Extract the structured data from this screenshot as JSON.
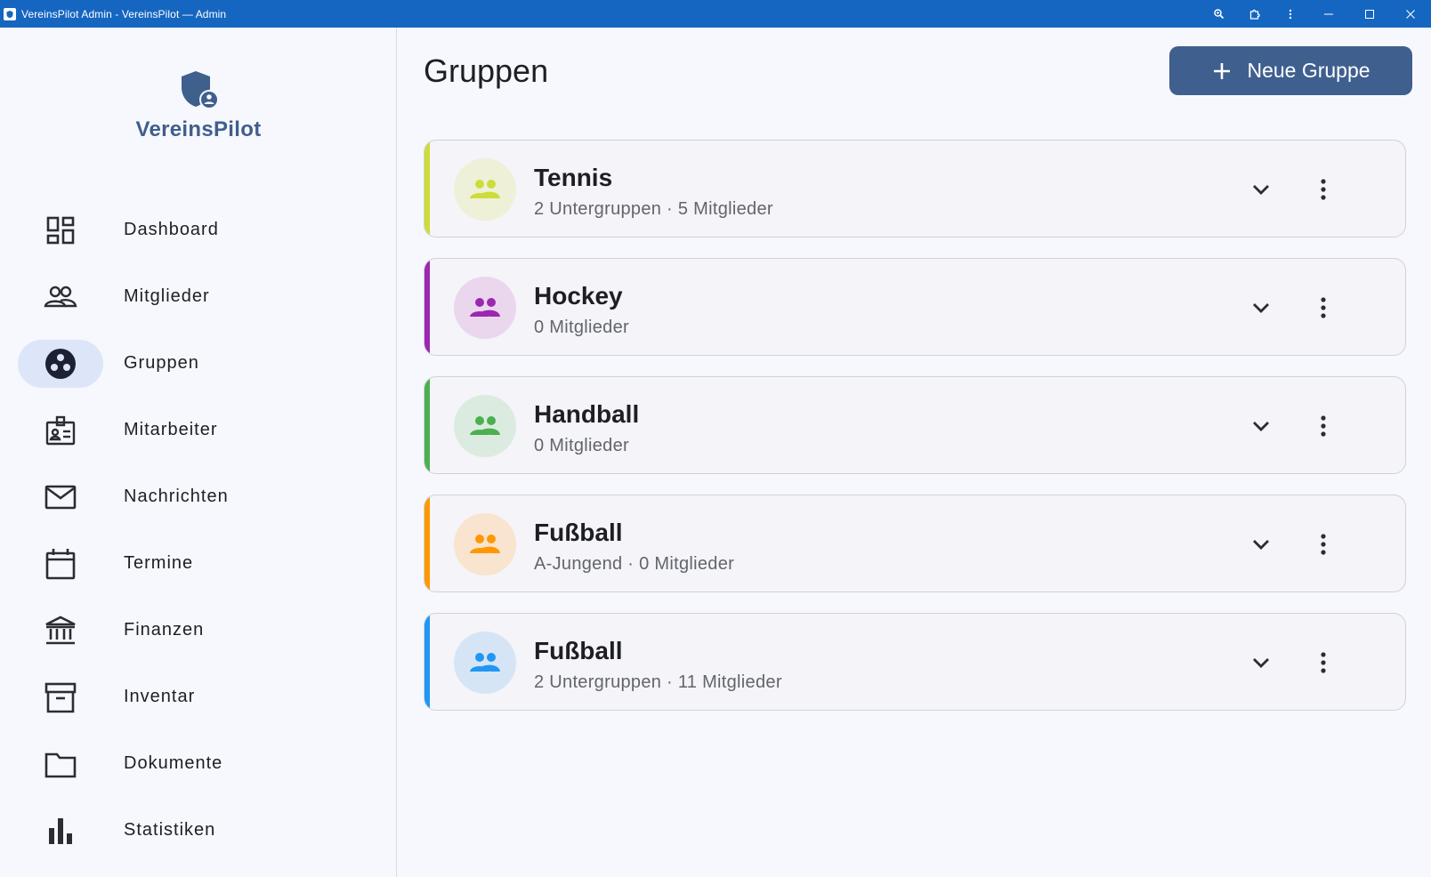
{
  "window": {
    "title": "VereinsPilot Admin - VereinsPilot — Admin",
    "controls": [
      "zoom-icon",
      "extensions-icon",
      "more-vert-icon",
      "minimize-icon",
      "maximize-icon",
      "close-icon"
    ]
  },
  "brand": {
    "name": "VereinsPilot",
    "logo_icon": "shield-user-icon",
    "color": "#3f5f8c"
  },
  "sidebar": {
    "items": [
      {
        "label": "Dashboard",
        "icon": "dashboard-icon",
        "active": false
      },
      {
        "label": "Mitglieder",
        "icon": "people-icon",
        "active": false
      },
      {
        "label": "Gruppen",
        "icon": "workspaces-icon",
        "active": true
      },
      {
        "label": "Mitarbeiter",
        "icon": "badge-icon",
        "active": false
      },
      {
        "label": "Nachrichten",
        "icon": "mail-icon",
        "active": false
      },
      {
        "label": "Termine",
        "icon": "calendar-icon",
        "active": false
      },
      {
        "label": "Finanzen",
        "icon": "bank-icon",
        "active": false
      },
      {
        "label": "Inventar",
        "icon": "archive-icon",
        "active": false
      },
      {
        "label": "Dokumente",
        "icon": "folder-icon",
        "active": false
      },
      {
        "label": "Statistiken",
        "icon": "bar-chart-icon",
        "active": false
      }
    ]
  },
  "main": {
    "title": "Gruppen",
    "new_button_label": "Neue Gruppe",
    "accent_color": "#3f5f8f",
    "groups": [
      {
        "name": "Tennis",
        "meta": "2 Untergruppen · 5 Mitglieder",
        "color": "#cddc39",
        "avatar_bg": "#eef1d8"
      },
      {
        "name": "Hockey",
        "meta": "0 Mitglieder",
        "color": "#9c27b0",
        "avatar_bg": "#ead7ee"
      },
      {
        "name": "Handball",
        "meta": "0 Mitglieder",
        "color": "#4caf50",
        "avatar_bg": "#dcebdf"
      },
      {
        "name": "Fußball",
        "meta": "A-Jungend · 0 Mitglieder",
        "color": "#ff9800",
        "avatar_bg": "#f8e4cf"
      },
      {
        "name": "Fußball",
        "meta": "2 Untergruppen · 11 Mitglieder",
        "color": "#2196f3",
        "avatar_bg": "#d6e5f5"
      }
    ]
  }
}
